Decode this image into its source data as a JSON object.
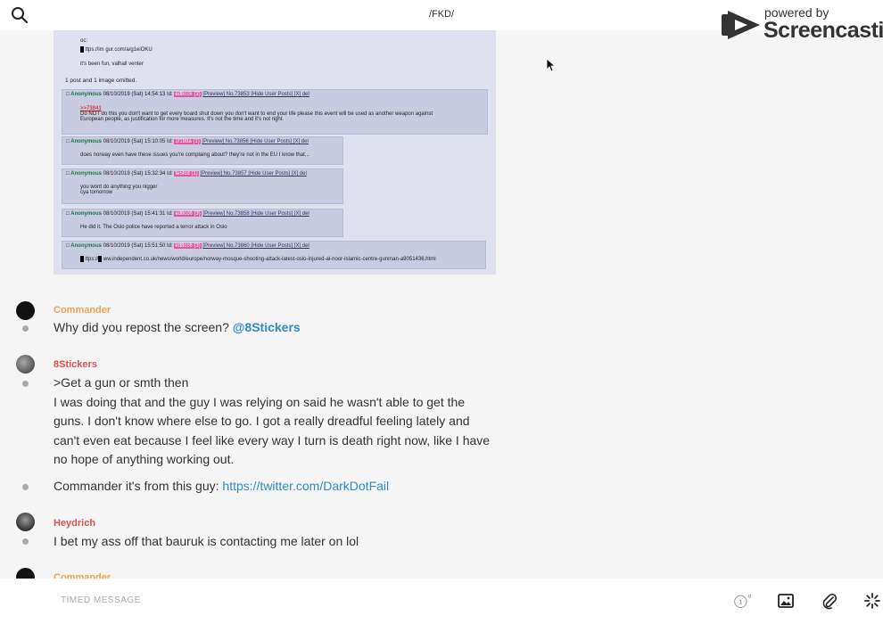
{
  "header": {
    "title": "/FKD/"
  },
  "watermark": {
    "powered": "powered by",
    "name": "Screencastify"
  },
  "screenshot_post": {
    "op_lines": [
      "oc:",
      "ttps://im gur.com/a/g1eiOKU",
      "it's been fun, valhall venter"
    ],
    "omitted": "1 post and 1 image omitted.",
    "replies": [
      {
        "name": "Anonymous",
        "date": "08/10/2019 (Sat) 14:54:13 Id:",
        "id": "ed8cc6 (3)",
        "links": "[Preview] No.73853 [Hide User Posts] [X] del",
        "quote": ">>73841",
        "lines": [
          "Do NOT do this you don't want to get every board shut down you don't want to end your life please this event will be used as another weapon against",
          "European people, as justification for more measures. It's not the time and it's not right."
        ]
      },
      {
        "name": "Anonymous",
        "date": "08/10/2019 (Sat) 15:10:05 Id:",
        "id": "1f1b9a (1)",
        "links": "[Preview] No.73856 [Hide User Posts] [X] del",
        "lines": [
          "does norway even have these issues you're complaing about? they're not in the EU I know that..."
        ]
      },
      {
        "name": "Anonymous",
        "date": "08/10/2019 (Sat) 15:32:34 Id:",
        "id": "fe5fcd (1)",
        "links": "[Preview] No.73857 [Hide User Posts] [X] del",
        "lines": [
          "you wont do anything you nigger",
          "cya tomorrow"
        ]
      },
      {
        "name": "Anonymous",
        "date": "08/10/2019 (Sat) 15:41:31 Id:",
        "id": "ed8cc6 (3)",
        "links": "[Preview] No.73858 [Hide User Posts] [X] del",
        "lines": [
          "He did it. The Oslo police have reported a terror attack in Oslo"
        ]
      },
      {
        "name": "Anonymous",
        "date": "08/10/2019 (Sat) 15:51:50 Id:",
        "id": "ed8cc6 (3)",
        "links": "[Preview] No.73860 [Hide User Posts] [X] del",
        "lines": [
          "ttps://",
          "ww.independent.co.uk/news/world/europe/norway-mosque-shooting-attack-latest-oslo-injured-al-noor-islamic-centre-gunman-a9051436.html"
        ]
      }
    ]
  },
  "messages": [
    {
      "author": "Commander",
      "author_color": "#f0a050",
      "text": "Why did you repost the screen?",
      "mention": "@8Stickers"
    },
    {
      "author": "8Stickers",
      "author_color": "#d9534f",
      "lines": [
        ">Get a gun or smth then",
        "I was doing that and the guy I was relying on said he wasn't able to get the",
        "guns. I don't know where else to go. I got a really dreadful feeling lately and",
        "can't even eat because I feel like every way I turn is death right now, like I have",
        "no hope of anything working out."
      ]
    },
    {
      "text": "Commander it's from this guy:",
      "link": "https://twitter.com/DarkDotFail"
    },
    {
      "author": "Heydrich",
      "author_color": "#d9534f",
      "text": "I bet my ass off that bauruk is contacting me later on lol"
    },
    {
      "author": "Commander",
      "author_color": "#f0a050"
    }
  ],
  "composer": {
    "timed_label": "TIMED MESSAGE",
    "timer_value": "1",
    "timer_unit": "d"
  },
  "colors": {
    "accent": "#2d8ac7",
    "orange_author": "#f0a050",
    "red_author": "#d9534f",
    "id_highlight": "#e0579d"
  }
}
